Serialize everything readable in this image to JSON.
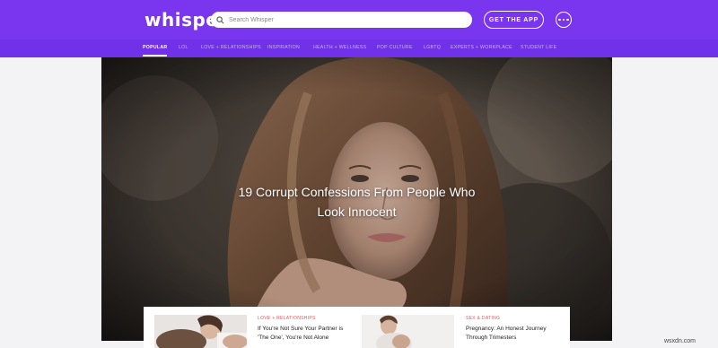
{
  "header": {
    "logo": "whisper",
    "search_placeholder": "Search Whisper",
    "get_app_label": "GET THE APP"
  },
  "nav": {
    "items": [
      "POPULAR",
      "LOL",
      "LOVE + RELATIONSHIPS",
      "INSPIRATION",
      "HEALTH + WELLNESS",
      "POP CULTURE",
      "LGBTQ",
      "EXPERTS + WORKPLACE",
      "STUDENT LIFE"
    ],
    "active": "POPULAR"
  },
  "hero": {
    "title_line1": "19 Corrupt Confessions From People Who",
    "title_line2": "Look Innocent"
  },
  "cards": [
    {
      "category": "LOVE + RELATIONSHIPS",
      "title_line1": "If You're Not Sure Your Partner is",
      "title_line2": "'The One', You're Not Alone"
    },
    {
      "category": "SEX & DATING",
      "title_line1": "Pregnancy: An Honest Journey",
      "title_line2": "Through Trimesters"
    }
  ],
  "watermark": "wsxdn.com",
  "colors": {
    "header_bg": "#7a35ee",
    "nav_bg": "#7131e8",
    "category_red": "#e2575f"
  }
}
